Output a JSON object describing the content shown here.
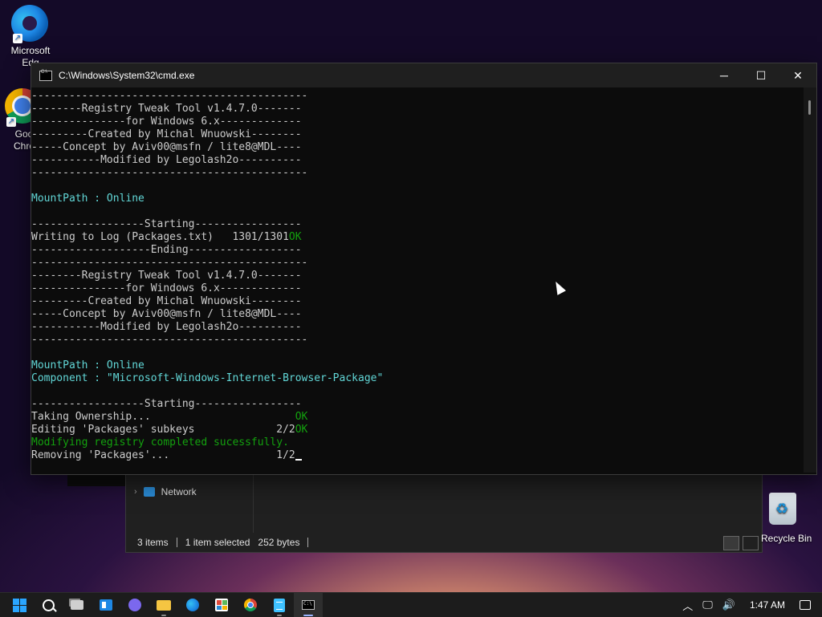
{
  "desktop": {
    "icons": [
      {
        "label": "Microsoft Edge",
        "visible_label": "Microsoft\nEdg"
      },
      {
        "label": "Google Chrome",
        "visible_label": "Goo\nChro"
      }
    ],
    "recycle_bin_label": "Recycle Bin"
  },
  "explorer": {
    "nav_item": "Network",
    "status_items": "3 items",
    "status_selected": "1 item selected",
    "status_size": "252 bytes"
  },
  "cmd": {
    "title": "C:\\Windows\\System32\\cmd.exe",
    "lines": [
      {
        "text": "--------------------------------------------",
        "color": "default"
      },
      {
        "text": "--------Registry Tweak Tool v1.4.7.0-------",
        "color": "default"
      },
      {
        "text": "---------------for Windows 6.x-------------",
        "color": "default"
      },
      {
        "text": "---------Created by Michal Wnuowski--------",
        "color": "default"
      },
      {
        "text": "-----Concept by Aviv00@msfn / lite8@MDL----",
        "color": "default"
      },
      {
        "text": "-----------Modified by Legolash2o----------",
        "color": "default"
      },
      {
        "text": "--------------------------------------------",
        "color": "default"
      },
      {
        "text": "",
        "color": "default"
      },
      {
        "text": "MountPath : Online",
        "color": "cyan"
      },
      {
        "text": "",
        "color": "default"
      },
      {
        "text": "------------------Starting-----------------",
        "color": "default"
      },
      {
        "text": "Writing to Log (Packages.txt)   1301/1301",
        "suffix": "OK",
        "color": "default"
      },
      {
        "text": "-------------------Ending------------------",
        "color": "default"
      },
      {
        "text": "--------------------------------------------",
        "color": "default"
      },
      {
        "text": "--------Registry Tweak Tool v1.4.7.0-------",
        "color": "default"
      },
      {
        "text": "---------------for Windows 6.x-------------",
        "color": "default"
      },
      {
        "text": "---------Created by Michal Wnuowski--------",
        "color": "default"
      },
      {
        "text": "-----Concept by Aviv00@msfn / lite8@MDL----",
        "color": "default"
      },
      {
        "text": "-----------Modified by Legolash2o----------",
        "color": "default"
      },
      {
        "text": "--------------------------------------------",
        "color": "default"
      },
      {
        "text": "",
        "color": "default"
      },
      {
        "text": "MountPath : Online",
        "color": "cyan"
      },
      {
        "text": "Component : \"Microsoft-Windows-Internet-Browser-Package\"",
        "color": "cyan"
      },
      {
        "text": "",
        "color": "default"
      },
      {
        "text": "------------------Starting-----------------",
        "color": "default"
      },
      {
        "text": "Taking Ownership...                       ",
        "suffix": "OK",
        "color": "default"
      },
      {
        "text": "Editing 'Packages' subkeys             2/2",
        "suffix": "OK",
        "color": "default"
      },
      {
        "text": "Modifying registry completed sucessfully.",
        "color": "green"
      },
      {
        "text": "Removing 'Packages'...                 1/2",
        "cursor": true,
        "color": "default"
      }
    ]
  },
  "taskbar": {
    "apps": [
      "Start",
      "Search",
      "Task View",
      "Widgets",
      "Chat",
      "File Explorer",
      "Microsoft Edge",
      "Microsoft Store",
      "Google Chrome",
      "Notepad",
      "Command Prompt"
    ],
    "clock": "1:47 AM"
  },
  "colors": {
    "console_bg": "#0c0c0c",
    "console_text": "#cccccc",
    "console_cyan": "#61d6d6",
    "console_green": "#13a10e",
    "taskbar_bg": "#1c1c1c",
    "accent": "#2aa5ff"
  }
}
